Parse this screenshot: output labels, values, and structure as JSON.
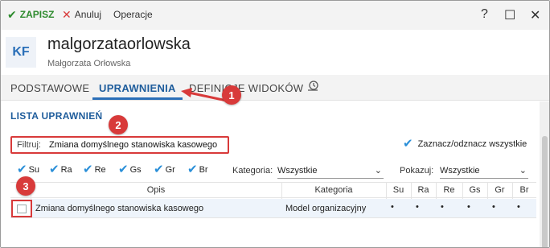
{
  "toolbar": {
    "save_label": "ZAPISZ",
    "cancel_label": "Anuluj",
    "operations_label": "Operacje",
    "help": "?",
    "maximize": "☐",
    "close": "✕"
  },
  "header": {
    "avatar_initials": "KF",
    "login": "malgorzataorlowska",
    "full_name": "Małgorzata Orłowska"
  },
  "tabs": [
    {
      "label": "PODSTAWOWE",
      "active": false
    },
    {
      "label": "UPRAWNIENIA",
      "active": true
    },
    {
      "label": "DEFINICJE WIDOKÓW",
      "active": false
    }
  ],
  "permissions": {
    "section_title": "LISTA UPRAWNIEŃ",
    "filter_label": "Filtruj:",
    "filter_value": "Zmiana domyślnego stanowiska kasowego",
    "check_all_label": "Zaznacz/odznacz wszystkie",
    "flags": [
      "Su",
      "Ra",
      "Re",
      "Gs",
      "Gr",
      "Br"
    ],
    "category_label": "Kategoria:",
    "category_value": "Wszystkie",
    "show_label": "Pokazuj:",
    "show_value": "Wszystkie",
    "columns": {
      "opis": "Opis",
      "kategoria": "Kategoria",
      "su": "Su",
      "ra": "Ra",
      "re": "Re",
      "gs": "Gs",
      "gr": "Gr",
      "br": "Br"
    },
    "rows": [
      {
        "opis": "Zmiana domyślnego stanowiska kasowego",
        "kategoria": "Model organizacyjny",
        "su": "•",
        "ra": "•",
        "re": "•",
        "gs": "•",
        "gr": "•",
        "br": "•"
      }
    ]
  },
  "annotations": [
    "1",
    "2",
    "3"
  ],
  "colors": {
    "accent": "#2a6fb8",
    "save_green": "#2e8b2e",
    "annotation_red": "#d83a3a",
    "check_blue": "#2a8fd8"
  }
}
